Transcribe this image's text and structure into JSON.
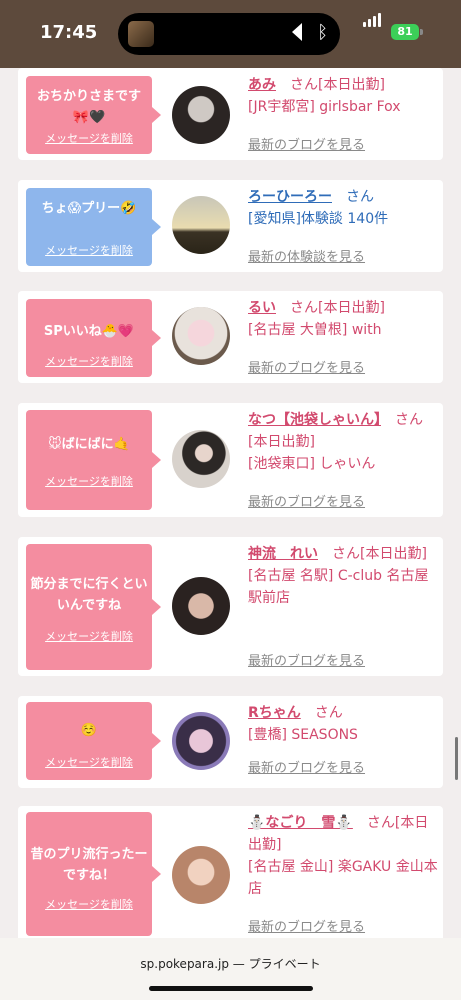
{
  "status": {
    "time": "17:45",
    "battery": "81"
  },
  "cards": [
    {
      "message": "おちかりさまです🎀🖤",
      "delete": "メッセージを削除",
      "name": "あみ",
      "san": "さん",
      "status": "[本日出勤]",
      "shop": "[JR宇都宮] girlsbar Fox",
      "link": "最新のブログを見る"
    },
    {
      "message": "ちょ😱プリー🤣",
      "delete": "メッセージを削除",
      "name": "ろーひーろー",
      "san": "さん",
      "status": "",
      "shop": "[愛知県]体験談 140件",
      "link": "最新の体験談を見る"
    },
    {
      "message": "SPいいね🐣💗",
      "delete": "メッセージを削除",
      "name": "るい",
      "san": "さん",
      "status": "[本日出勤]",
      "shop": "[名古屋 大曽根] with",
      "link": "最新のブログを見る"
    },
    {
      "message": "🐭ばにばに🤙",
      "delete": "メッセージを削除",
      "name": "なつ【池袋しゃいん】",
      "san": "さん",
      "status": "[本日出勤]",
      "shop": "[池袋東口] しゃいん",
      "link": "最新のブログを見る"
    },
    {
      "message": "節分までに行くといいんですね",
      "delete": "メッセージを削除",
      "name": "神流　れい",
      "san": "さん",
      "status": "[本日出勤]",
      "shop": "[名古屋 名駅] C-club 名古屋駅前店",
      "link": "最新のブログを見る"
    },
    {
      "message": "☺️",
      "delete": "メッセージを削除",
      "name": "Rちゃん",
      "san": "さん",
      "status": "",
      "shop": "[豊橋] SEASONS",
      "link": "最新のブログを見る"
    },
    {
      "message": "昔のプリ流行ったーですね！",
      "delete": "メッセージを削除",
      "name": "⛄なごり　雪⛄",
      "san": "さん",
      "status": "[本日出勤]",
      "shop": "[名古屋 金山] 楽GAKU 金山本店",
      "link": "最新のブログを見る"
    }
  ],
  "browser": {
    "url": "sp.pokepara.jp — プライベート"
  }
}
